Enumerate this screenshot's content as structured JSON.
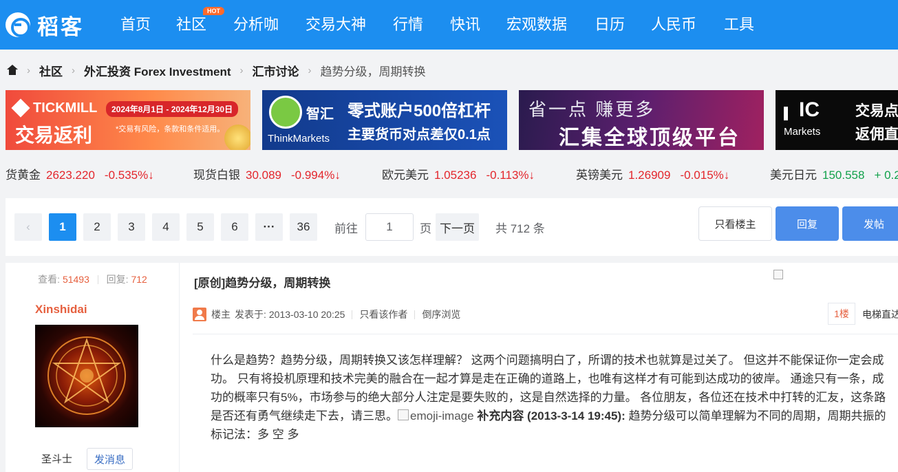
{
  "header": {
    "logo_text": "稻客",
    "nav": [
      "首页",
      "社区",
      "分析咖",
      "交易大神",
      "行情",
      "快讯",
      "宏观数据",
      "日历",
      "人民币",
      "工具"
    ],
    "hot_badge": "HOT"
  },
  "breadcrumb": {
    "items": [
      "社区",
      "外汇投资 Forex Investment",
      "汇市讨论"
    ],
    "current": "趋势分级，周期转换"
  },
  "banners": [
    {
      "brand": "TICKMILL",
      "date": "2024年8月1日 - 2024年12月30日",
      "title": "交易返利",
      "note": "*交易有风险，条款和条件适用。"
    },
    {
      "brand": "智汇",
      "brand_en": "ThinkMarkets",
      "line1": "零式账户500倍杠杆",
      "line2": "主要货币对点差仅0.1点"
    },
    {
      "line1": "省一点 赚更多",
      "line2": "汇集全球顶级平台"
    },
    {
      "brand": "IC",
      "brand_en": "Markets",
      "line1": "交易点",
      "line2": "返佣直"
    }
  ],
  "ticker": [
    {
      "name": "货黄金",
      "price": "2623.220",
      "change": "-0.535%",
      "arrow": "↓",
      "dir": "down"
    },
    {
      "name": "现货白银",
      "price": "30.089",
      "change": "-0.994%",
      "arrow": "↓",
      "dir": "down"
    },
    {
      "name": "欧元美元",
      "price": "1.05236",
      "change": "-0.113%",
      "arrow": "↓",
      "dir": "down"
    },
    {
      "name": "英镑美元",
      "price": "1.26909",
      "change": "-0.015%",
      "arrow": "↓",
      "dir": "down"
    },
    {
      "name": "美元日元",
      "price": "150.558",
      "change": "+ 0.2",
      "arrow": "",
      "dir": "up"
    }
  ],
  "pager": {
    "prev": "‹",
    "pages": [
      "1",
      "2",
      "3",
      "4",
      "5",
      "6"
    ],
    "ellipsis": "···",
    "last": "36",
    "goto_label": "前往",
    "goto_value": "1",
    "page_unit": "页",
    "next": "下一页",
    "total": "共 712 条",
    "only_host": "只看楼主",
    "reply": "回复",
    "new_post": "发帖"
  },
  "post": {
    "views_label": "查看:",
    "views": "51493",
    "replies_label": "回复:",
    "replies": "712",
    "author": "Xinshidai",
    "rank": "圣斗士",
    "send_msg": "发消息",
    "title": "[原创]趋势分级，周期转换",
    "role": "楼主",
    "posted_label": "发表于:",
    "posted_at": "2013-03-10 20:25",
    "only_author": "只看该作者",
    "reverse": "倒序浏览",
    "floor": "1楼",
    "elevator": "电梯直达",
    "body_text": "什么是趋势？趋势分级，周期转换又该怎样理解？ 这两个问题搞明白了，所谓的技术也就算是过关了。 但这并不能保证你一定会成功。 只有将投机原理和技术完美的融合在一起才算是走在正确的道路上，也唯有这样才有可能到达成功的彼岸。 通途只有一条，成功的概率只有5%，市场参与的绝大部分人注定是要失败的，这是自然选择的力量。 各位朋友，各位还在技术中打转的汇友，这条路是否还有勇气继续走下去，请三思。",
    "emoji_alt": "emoji-image",
    "supplement_label": "补充内容 (2013-3-14 19:45):",
    "supplement_text": " 趋势分级可以简单理解为不同的周期，周期共振的标记法：多 空 多"
  },
  "colors": {
    "nav_bg": "#1c8ef0",
    "accent": "#e6603f",
    "down": "#e3262c",
    "up": "#12a14b",
    "button": "#4c8dea"
  }
}
